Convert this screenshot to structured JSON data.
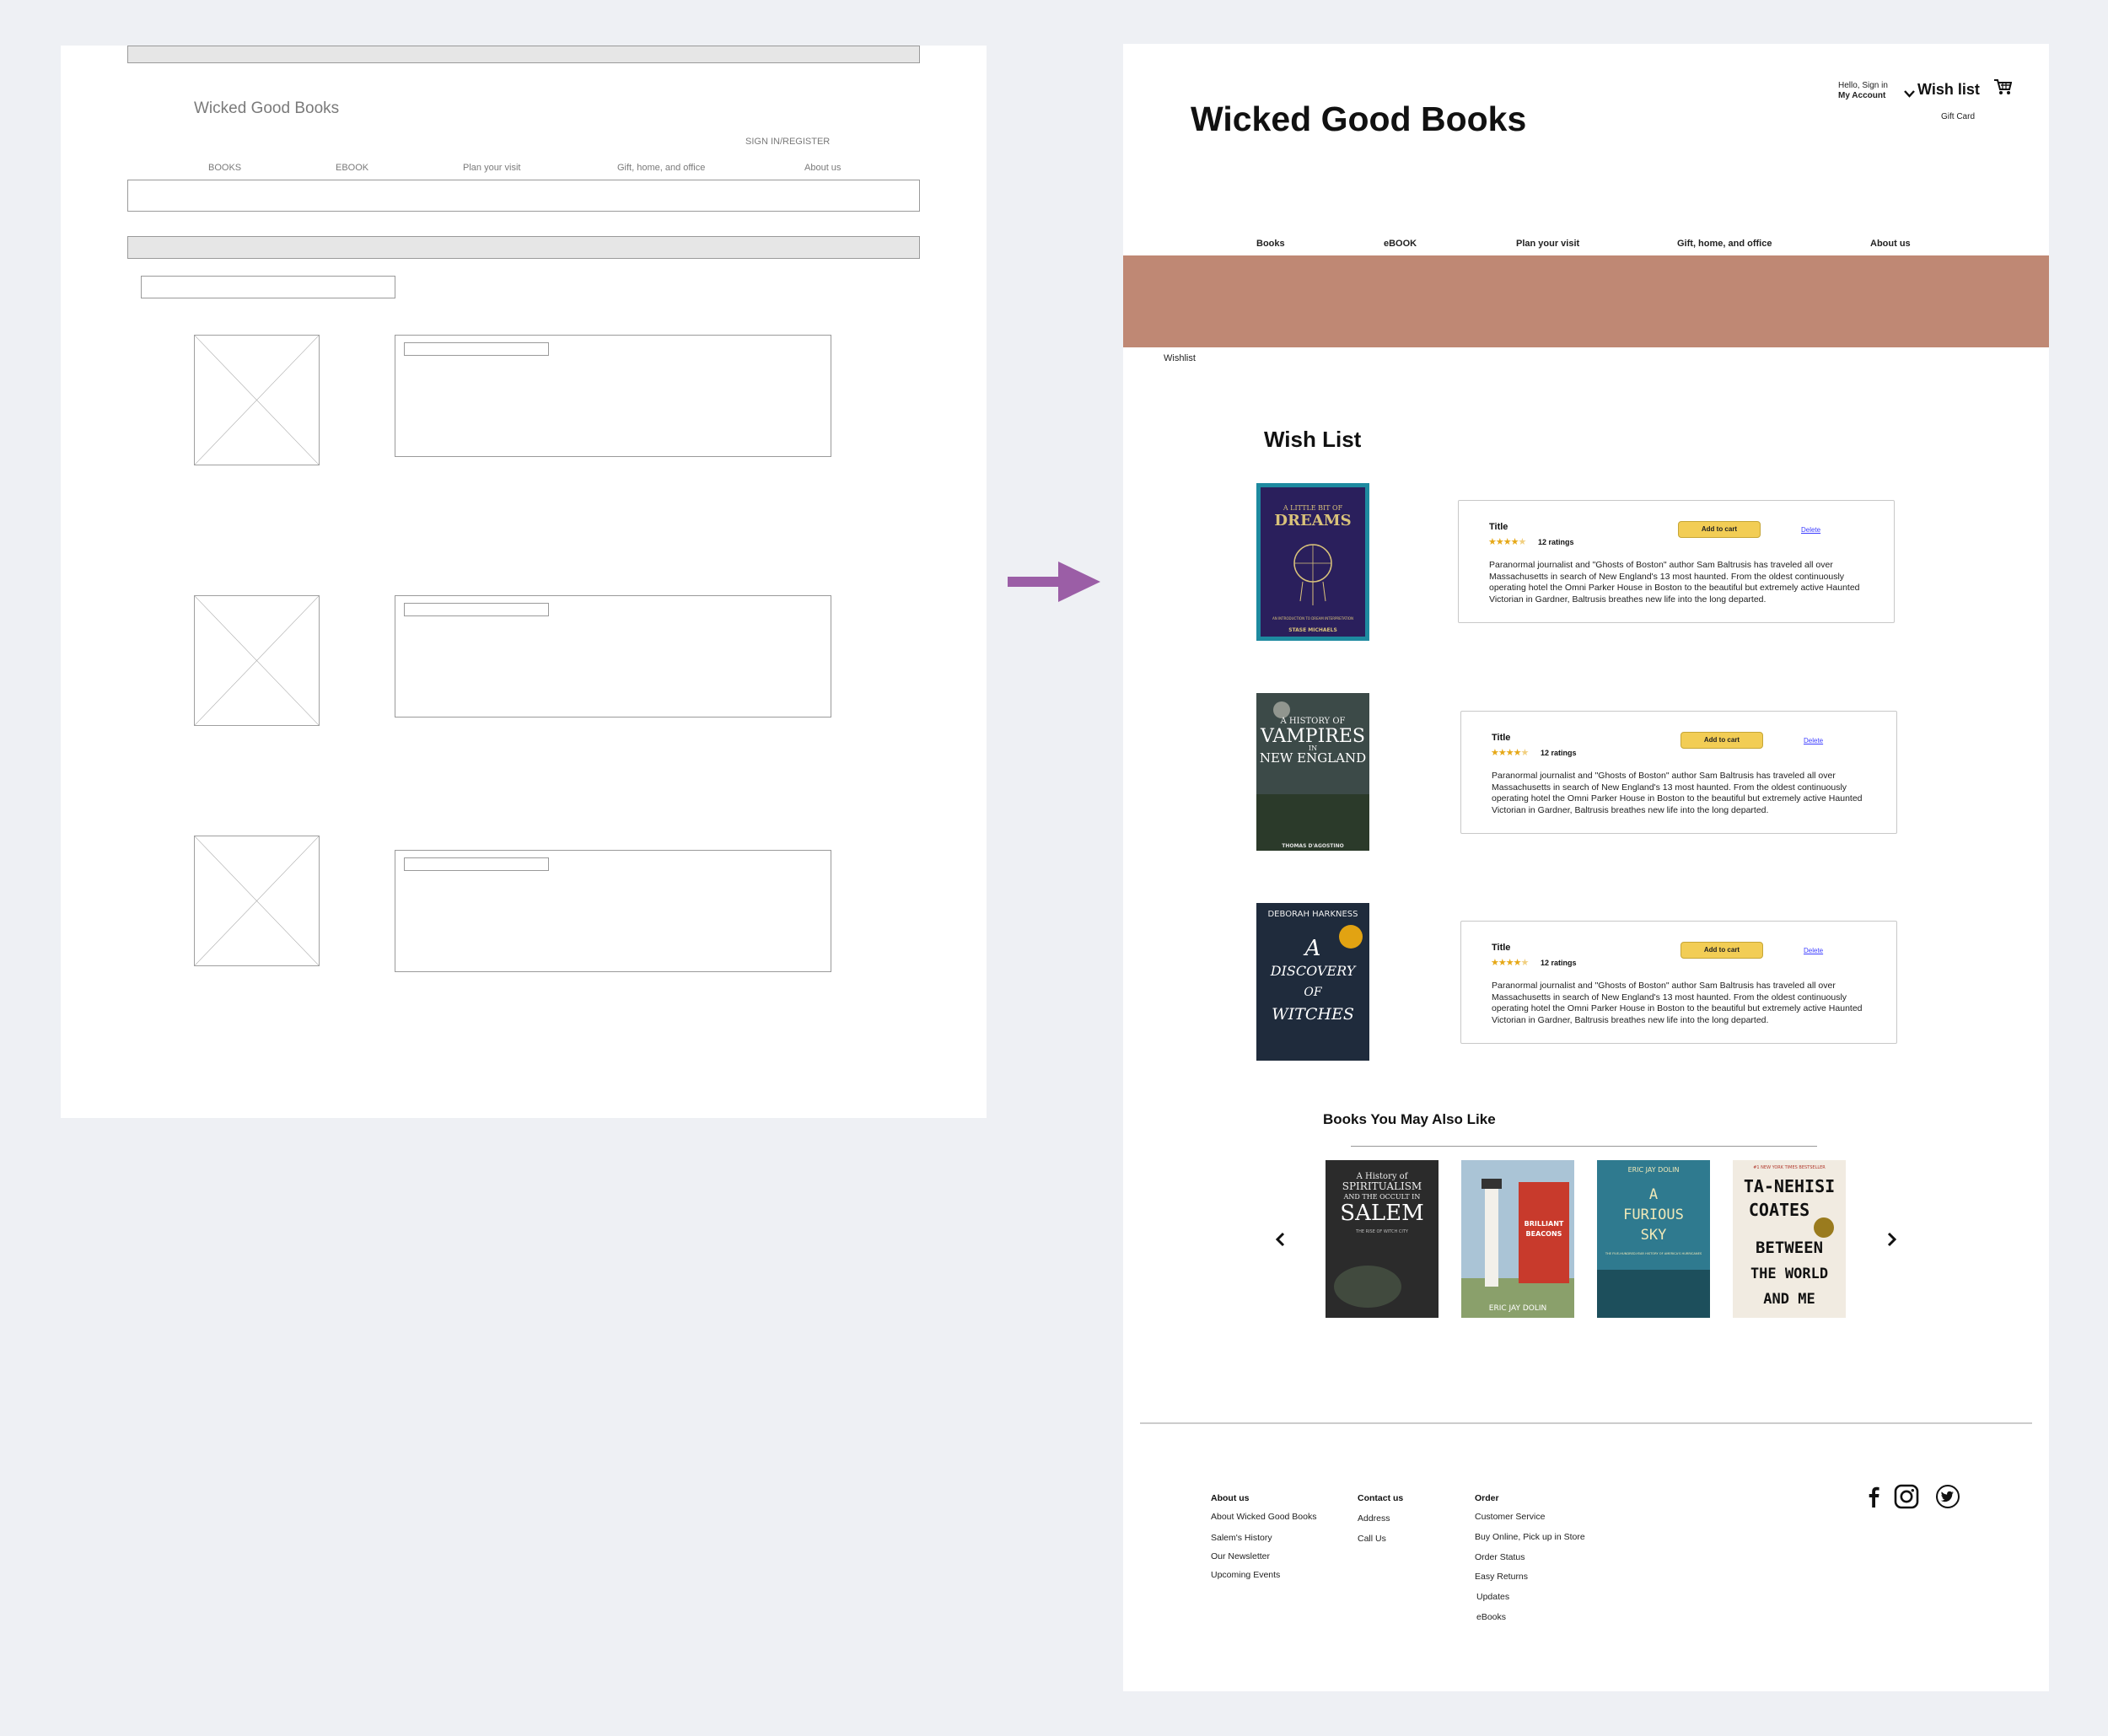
{
  "wireframe": {
    "brand": "Wicked Good Books",
    "sign_in": "SIGN IN/REGISTER",
    "nav": [
      "BOOKS",
      "EBOOK",
      "Plan your visit",
      "Gift, home, and office",
      "About us"
    ]
  },
  "header": {
    "brand": "Wicked Good Books",
    "greeting": "Hello, Sign in",
    "account": "My Account",
    "wishlist": "Wish list",
    "gift_card": "Gift Card"
  },
  "nav": [
    "Books",
    "eBOOK",
    "Plan your visit",
    "Gift, home, and office",
    "About us"
  ],
  "colors": {
    "banner": "#bf8874",
    "add_to_cart": "#f2cd55",
    "arrow": "#9b5ea6"
  },
  "breadcrumb": "Wishlist",
  "wishlist": {
    "heading": "Wish List",
    "items": [
      {
        "title": "Title",
        "rating": 4.5,
        "ratings": "12 ratings",
        "add_label": "Add to cart",
        "delete_label": "Delete",
        "description": "Paranormal journalist and \"Ghosts of Boston\" author Sam Baltrusis has traveled all over Massachusetts in search of New England's 13 most haunted. From the oldest continuously operating hotel the Omni Parker House in Boston to the beautiful but extremely active Haunted Victorian in Gardner, Baltrusis breathes new life into the long departed.",
        "cover": {
          "lines": [
            "A LITTLE BIT OF",
            "DREAMS"
          ],
          "sub": "AN INTRODUCTION TO DREAM INTERPRETATION",
          "author": "STASE MICHAELS"
        }
      },
      {
        "title": "Title",
        "rating": 4.5,
        "ratings": "12 ratings",
        "add_label": "Add to cart",
        "delete_label": "Delete",
        "description": "Paranormal journalist and \"Ghosts of Boston\" author Sam Baltrusis has traveled all over Massachusetts in search of New England's 13 most haunted. From the oldest continuously operating hotel the Omni Parker House in Boston to the beautiful but extremely active Haunted Victorian in Gardner, Baltrusis breathes new life into the long departed.",
        "cover": {
          "lines": [
            "A HISTORY OF",
            "VAMPIRES",
            "IN",
            "NEW ENGLAND"
          ],
          "author": "THOMAS D'AGOSTINO"
        }
      },
      {
        "title": "Title",
        "rating": 4.5,
        "ratings": "12 ratings",
        "add_label": "Add to cart",
        "delete_label": "Delete",
        "description": "Paranormal journalist and \"Ghosts of Boston\" author Sam Baltrusis has traveled all over Massachusetts in search of New England's 13 most haunted. From the oldest continuously operating hotel the Omni Parker House in Boston to the beautiful but extremely active Haunted Victorian in Gardner, Baltrusis breathes new life into the long departed.",
        "cover": {
          "lines": [
            "DEBORAH HARKNESS",
            "A",
            "DISCOVERY",
            "OF",
            "WITCHES"
          ]
        }
      }
    ]
  },
  "recommendations": {
    "heading": "Books You May Also Like",
    "books": [
      {
        "lines": [
          "A History of",
          "SPIRITUALISM",
          "AND THE OCCULT IN",
          "SALEM"
        ],
        "sub": "THE RISE OF WITCH CITY"
      },
      {
        "lines": [
          "BRILLIANT",
          "BEACONS"
        ],
        "author": "ERIC JAY DOLIN"
      },
      {
        "lines": [
          "ERIC JAY DOLIN",
          "A",
          "FURIOUS",
          "SKY"
        ],
        "sub": "THE FIVE-HUNDRED-YEAR HISTORY OF AMERICA'S HURRICANES"
      },
      {
        "lines": [
          "TA-NEHISI",
          "COATES",
          "BETWEEN",
          "THE WORLD",
          "AND ME"
        ],
        "top": "#1 NEW YORK TIMES BESTSELLER"
      }
    ]
  },
  "footer": {
    "columns": [
      {
        "heading": "About us",
        "items": [
          "About Wicked Good Books",
          "Salem's History",
          "Our Newsletter",
          "Upcoming Events"
        ]
      },
      {
        "heading": "Contact us",
        "items": [
          "Address",
          "Call Us"
        ]
      },
      {
        "heading": "Order",
        "items": [
          "Customer Service",
          "Buy Online, Pick up in Store",
          "Order Status",
          "Easy Returns",
          "Updates",
          "eBooks"
        ]
      }
    ],
    "social": [
      "facebook-icon",
      "instagram-icon",
      "twitter-icon"
    ]
  }
}
